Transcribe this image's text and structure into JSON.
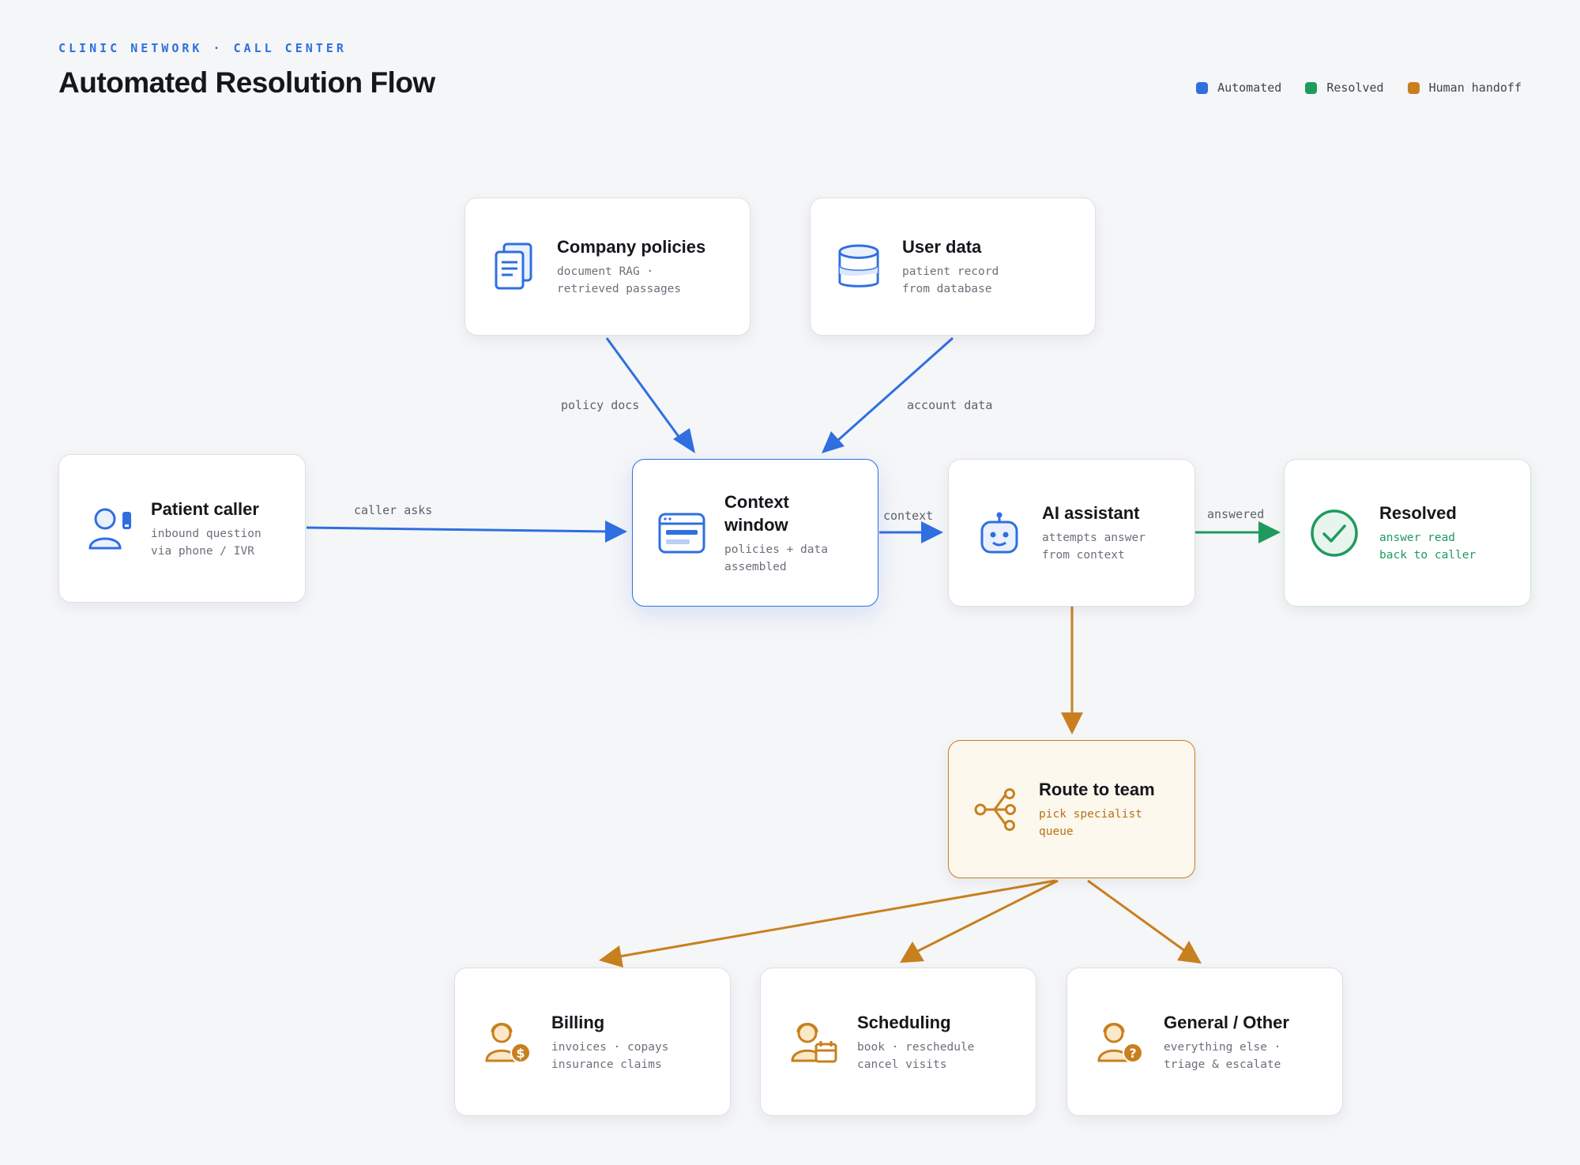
{
  "header": {
    "eyebrow": "CLINIC NETWORK · CALL CENTER",
    "title": "Automated Resolution Flow"
  },
  "legend": [
    {
      "label": "Automated",
      "color": "#2f6fe0"
    },
    {
      "label": "Resolved",
      "color": "#1f9a5e"
    },
    {
      "label": "Human handoff",
      "color": "#c8801e"
    }
  ],
  "colors": {
    "automated": "#2f6fe0",
    "resolved": "#1f9a5e",
    "handoff": "#c8801e"
  },
  "nodes": {
    "policies": {
      "title": "Company policies",
      "subtitle": "document RAG ·\nretrieved passages",
      "icon": "documents-icon"
    },
    "userdata": {
      "title": "User data",
      "subtitle": "patient record\nfrom database",
      "icon": "database-icon"
    },
    "caller": {
      "title": "Patient caller",
      "subtitle": "inbound question\nvia phone / IVR",
      "icon": "caller-icon"
    },
    "context": {
      "title": "Context\nwindow",
      "subtitle": "policies + data\nassembled",
      "icon": "window-icon"
    },
    "assistant": {
      "title": "AI assistant",
      "subtitle": "attempts answer\nfrom context",
      "icon": "robot-icon"
    },
    "resolved": {
      "title": "Resolved",
      "subtitle": "answer read\nback to caller",
      "icon": "check-circle-icon"
    },
    "route": {
      "title": "Route to team",
      "subtitle": "pick specialist\nqueue",
      "icon": "branch-icon"
    },
    "billing": {
      "title": "Billing",
      "subtitle": "invoices · copays\ninsurance claims",
      "icon": "agent-dollar-icon"
    },
    "scheduling": {
      "title": "Scheduling",
      "subtitle": "book · reschedule\ncancel visits",
      "icon": "agent-calendar-icon"
    },
    "general": {
      "title": "General / Other",
      "subtitle": "everything else ·\ntriage & escalate",
      "icon": "agent-question-icon"
    }
  },
  "edges": {
    "policy_docs": "policy docs",
    "account_data": "account data",
    "caller_asks": "caller asks",
    "context": "context",
    "answered": "answered"
  }
}
